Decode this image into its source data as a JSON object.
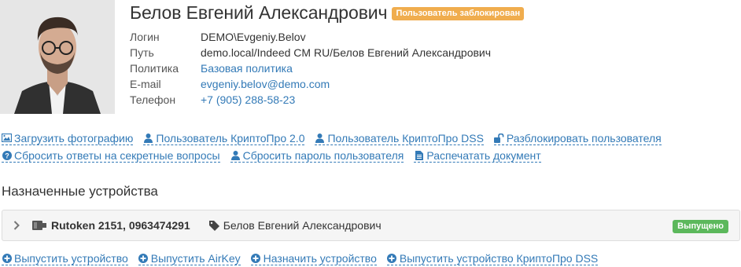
{
  "user": {
    "name": "Белов Евгений Александрович",
    "status_badge": "Пользователь заблокирован"
  },
  "properties": [
    {
      "label": "Логин",
      "value": "DEMO\\Evgeniy.Belov",
      "link": false
    },
    {
      "label": "Путь",
      "value": "demo.local/Indeed CM RU/Белов Евгений Александрович",
      "link": false
    },
    {
      "label": "Политика",
      "value": "Базовая политика",
      "link": true
    },
    {
      "label": "E-mail",
      "value": "evgeniy.belov@demo.com",
      "link": true
    },
    {
      "label": "Телефон",
      "value": "+7 (905) 288-58-23",
      "link": true
    }
  ],
  "actions": {
    "upload_photo": "Загрузить фотографию",
    "cryptopro_user": "Пользователь КриптоПро 2.0",
    "cryptopro_dss_user": "Пользователь КриптоПро DSS",
    "unblock_user": "Разблокировать пользователя",
    "reset_secret_answers": "Сбросить ответы на секретные вопросы",
    "reset_password": "Сбросить пароль пользователя",
    "print_document": "Распечатать документ"
  },
  "devices_section": {
    "title": "Назначенные устройства",
    "devices": [
      {
        "name": "Rutoken 2151, 0963474291",
        "owner": "Белов Евгений Александрович",
        "status": "Выпущено"
      }
    ]
  },
  "device_actions": {
    "issue_device": "Выпустить устройство",
    "issue_airkey": "Выпустить AirKey",
    "assign_device": "Назначить устройство",
    "issue_cryptopro_dss_device": "Выпустить устройство КриптоПро DSS"
  },
  "colors": {
    "link": "#337ab7",
    "blocked_badge": "#f0ad4e",
    "issued_badge": "#5cb85c"
  },
  "icons": {
    "photo": "image-icon",
    "user": "user-icon",
    "unlock": "unlock-icon",
    "question": "question-circle-icon",
    "document": "document-icon",
    "expand": "chevron-right-icon",
    "device": "token-device-icon",
    "tag": "tag-icon",
    "add": "plus-circle-icon"
  }
}
